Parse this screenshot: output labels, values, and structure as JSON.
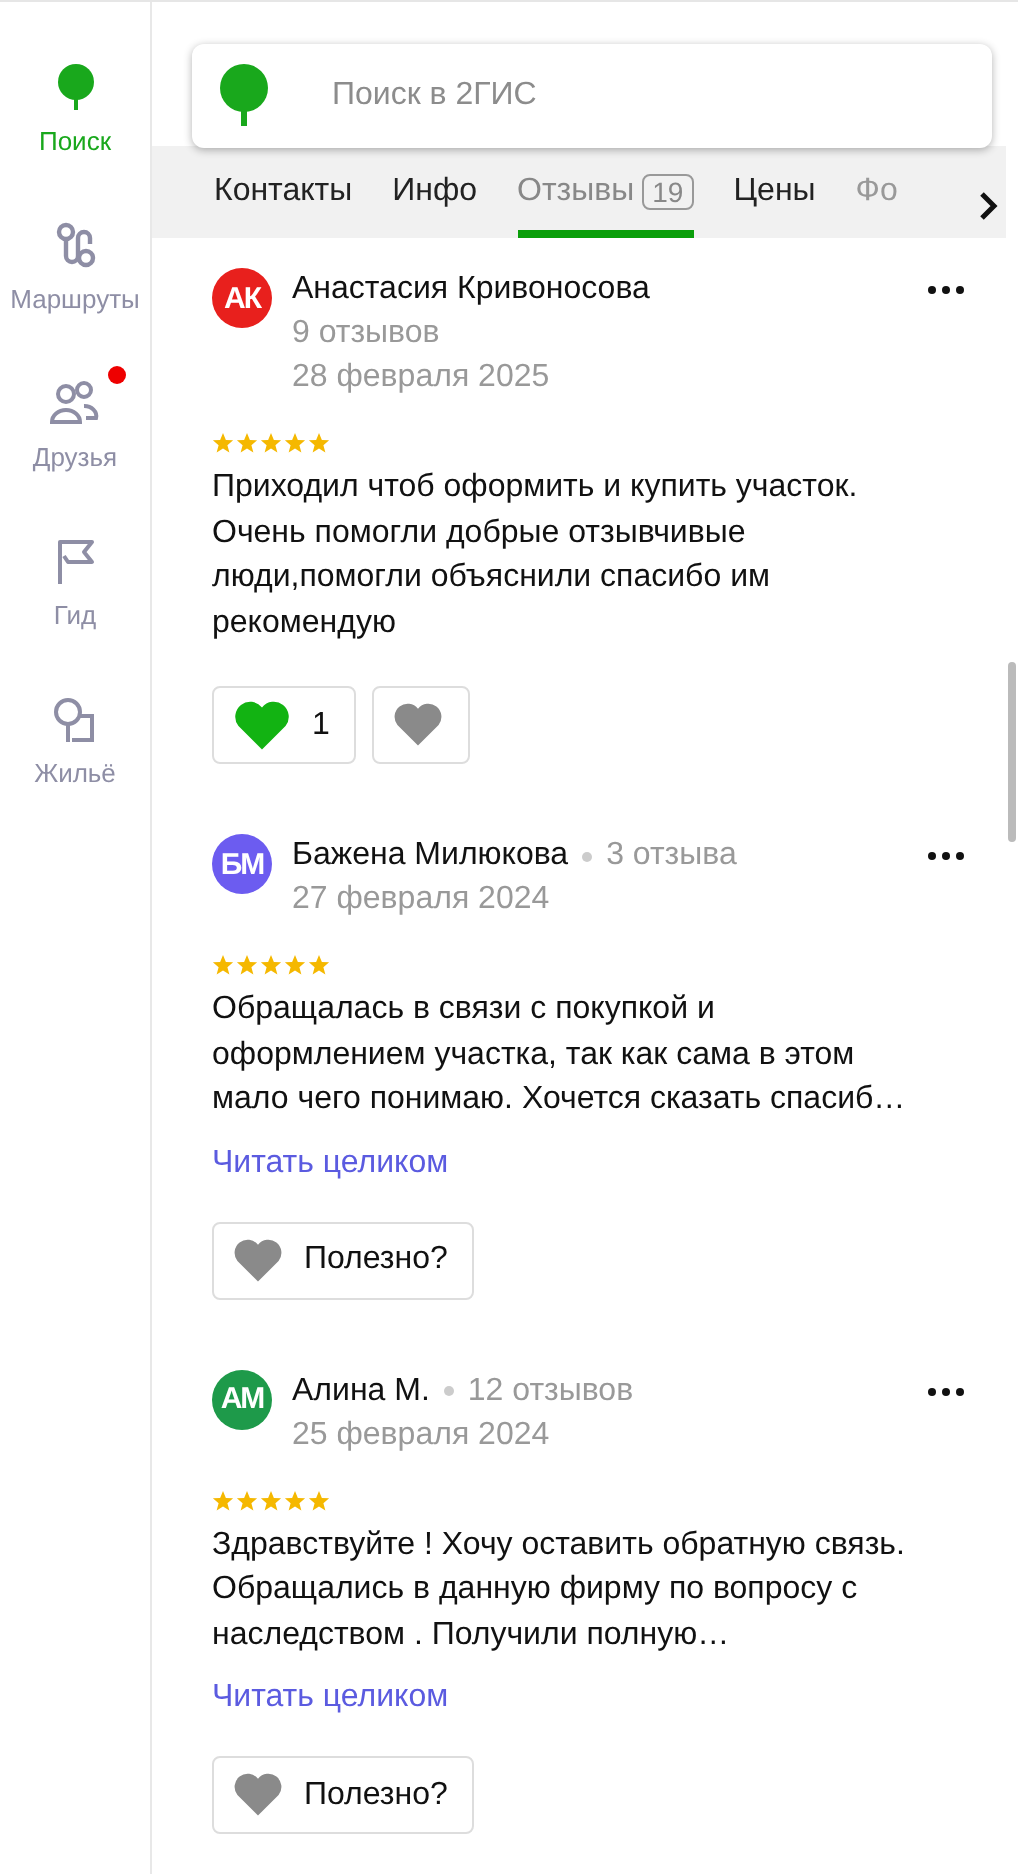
{
  "sidebar": {
    "items": [
      {
        "label": "Поиск",
        "selected": true,
        "notification": false
      },
      {
        "label": "Маршруты",
        "selected": false,
        "notification": false
      },
      {
        "label": "Друзья",
        "selected": false,
        "notification": true
      },
      {
        "label": "Гид",
        "selected": false,
        "notification": false
      },
      {
        "label": "Жильё",
        "selected": false,
        "notification": false
      }
    ]
  },
  "search": {
    "placeholder": "Поиск в 2ГИС"
  },
  "tabs": [
    {
      "label": "Контакты",
      "selected": false
    },
    {
      "label": "Инфо",
      "selected": false
    },
    {
      "label": "Отзывы",
      "badge": "19",
      "selected": true
    },
    {
      "label": "Цены",
      "selected": false
    },
    {
      "label": "Фо",
      "selected": false
    }
  ],
  "reviews": [
    {
      "initials": "АК",
      "color": "#e8201d",
      "name": "Анастасия Кривоносова",
      "count": "9 отзывов",
      "count_inline": false,
      "date": "28 февраля 2025",
      "stars": 5,
      "text": [
        "Приходил чтоб оформить и купить участок.",
        "Очень помогли добрые отзывчивые",
        "люди,помогли объяснили спасибо им",
        "рекомендую"
      ],
      "kind": "reactions",
      "likes": "1",
      "liked": true
    },
    {
      "initials": "БМ",
      "color": "#6c5cf0",
      "name": "Бажена Милюкова",
      "count": "3 отзыва",
      "count_inline": true,
      "date": "27 февраля 2024",
      "stars": 5,
      "text": [
        "Обращалась в связи с покупкой и",
        "оформлением участка, так как сама в этом",
        "мало чего понимаю. Хочется сказать спасиб…"
      ],
      "read_more": "Читать целиком",
      "kind": "useful",
      "useful": "Полезно?"
    },
    {
      "initials": "АМ",
      "color": "#1e9a4a",
      "name": "Алина М.",
      "count": "12 отзывов",
      "count_inline": true,
      "date": "25 февраля 2024",
      "stars": 5,
      "text": [
        "Здравствуйте ! Хочу оставить обратную связь.",
        "Обращались в данную фирму по вопросу с",
        "наследством . Получили полную…"
      ],
      "read_more": "Читать целиком",
      "kind": "useful",
      "useful": "Полезно?"
    }
  ]
}
